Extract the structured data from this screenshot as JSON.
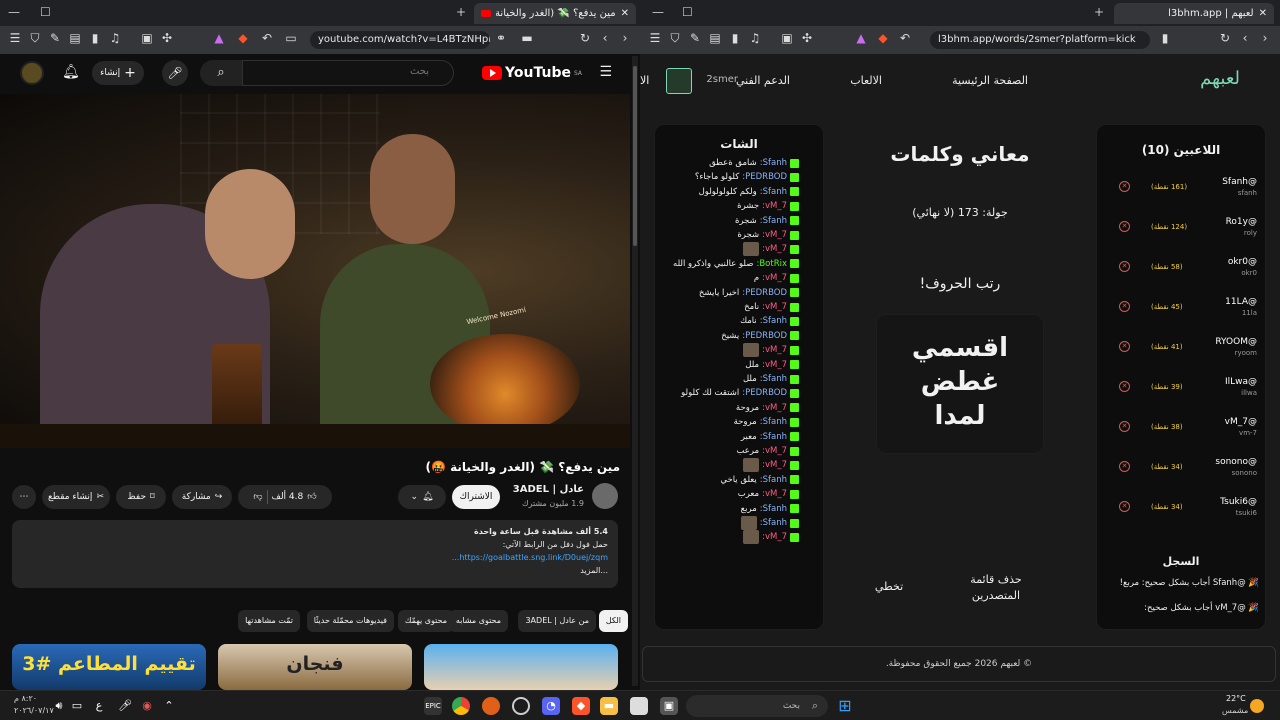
{
  "youtube_tab": {
    "title": "مين يدفع؟ 💸 (الغدر والخيانة🤬)",
    "url": "youtube.com/watch?v=L4BTzNHpHmc",
    "search_placeholder": "بحث",
    "create_label": "إنشاء",
    "logo": "YouTube",
    "country": "SA"
  },
  "video": {
    "title": "مين يدفع؟ 💸 (الغدر والخيانة 🤬)",
    "channel": "عادل | 3ADEL",
    "subscribers": "1.9 مليون مشترك",
    "subscribe_label": "الاشتراك",
    "likes": "4.8 ألف",
    "share_label": "مشاركة",
    "save_label": "حفظ",
    "clip_label": "إنشاء مقطع",
    "description": {
      "line1": "‎5.4 ألف مشاهدة قبل ساعة واحدة",
      "line2": "حمل فول دفل من الرابط الآتي:",
      "link": "https://goalbattle.sng.link/D0uej/zqm...",
      "more": "...المزيد"
    },
    "overlay_sign": "Welcome Nozomi"
  },
  "chips": [
    "الكل",
    "من عادل | 3ADEL",
    "محتوى مشابه",
    "محتوى يهمّك",
    "فيديوهات محمّلة حديثًا",
    "تمّت مشاهدتها"
  ],
  "thumbnails": [
    {
      "text": "تقييم المطاعم #3"
    },
    {
      "text": "فنجان"
    },
    {
      "text": ""
    }
  ],
  "l3bhm_tab": {
    "title": "لعبهم | l3bhm.app",
    "url": "l3bhm.app/words/2smer?platform=kick"
  },
  "nav": {
    "logo": "لعبهم",
    "home": "الصفحة الرئيسية",
    "games": "الالعاب",
    "support": "الدعم الفني",
    "user": "2smer",
    "extra": "الا"
  },
  "players": {
    "title": "اللاعبين (10)",
    "list": [
      {
        "name": "@Sfanh",
        "sub": "sfanh",
        "points": "(161 نقطة)"
      },
      {
        "name": "@Ro1y",
        "sub": "roly",
        "points": "(124 نقطة)"
      },
      {
        "name": "@okr0",
        "sub": "okr0",
        "points": "(58 نقطة)"
      },
      {
        "name": "@11LA",
        "sub": "11la",
        "points": "(45 نقطة)"
      },
      {
        "name": "@RYOOM",
        "sub": "ryoom",
        "points": "(41 نقطة)"
      },
      {
        "name": "@IlLwa",
        "sub": "illwa",
        "points": "(39 نقطة)"
      },
      {
        "name": "@vM_7",
        "sub": "vm-7",
        "points": "(38 نقطة)"
      },
      {
        "name": "@sonono",
        "sub": "sonono",
        "points": "(34 نقطة)"
      },
      {
        "name": "@Tsuki6",
        "sub": "tsuki6",
        "points": "(34 نقطة)"
      }
    ]
  },
  "log": {
    "title": "السجل",
    "entries": [
      "🎉 @Sfanh أجاب بشكل صحيح: مربع!",
      "🎉 @vM_7 أجاب بشكل صحيح:"
    ]
  },
  "game": {
    "title": "معاني وكلمات",
    "round": "جولة: 173 (لا نهائي)",
    "prompt": "رتب الحروف!",
    "scrambled": [
      "اقسمي",
      "غطض",
      "لمدا"
    ],
    "delete_leaderboard": "حذف قائمة المتصدرين",
    "skip": "تخطي"
  },
  "chat": {
    "title": "الشات",
    "messages": [
      {
        "user": "Sfanh:",
        "text": "شامق ةعطق",
        "c": ""
      },
      {
        "user": "PEDRBOD:",
        "text": "كلولو ماجاء؟",
        "c": ""
      },
      {
        "user": "Sfanh:",
        "text": "ولكم كلولولولول",
        "c": ""
      },
      {
        "user": "vM_7:",
        "text": "جشرة",
        "c": "red"
      },
      {
        "user": "Sfanh:",
        "text": "شجرة",
        "c": ""
      },
      {
        "user": "vM_7:",
        "text": "شجرة",
        "c": "red"
      },
      {
        "user": "vM_7:",
        "text": "",
        "c": "red",
        "avatar": true
      },
      {
        "user": "BotRix:",
        "text": "صلو عالنبي واذكرو الله",
        "c": "grn"
      },
      {
        "user": "vM_7:",
        "text": "م",
        "c": "red"
      },
      {
        "user": "PEDRBOD:",
        "text": "اخيرا يايشخ",
        "c": ""
      },
      {
        "user": "vM_7:",
        "text": "نامخ",
        "c": "red"
      },
      {
        "user": "Sfanh:",
        "text": "نامك",
        "c": ""
      },
      {
        "user": "PEDRBOD:",
        "text": "يشيخ",
        "c": ""
      },
      {
        "user": "vM_7:",
        "text": "",
        "c": "red",
        "avatar": true
      },
      {
        "user": "vM_7:",
        "text": "ملل",
        "c": "red"
      },
      {
        "user": "Sfanh:",
        "text": "ملل",
        "c": ""
      },
      {
        "user": "PEDRBOD:",
        "text": "اشتقت لك كلولو",
        "c": ""
      },
      {
        "user": "vM_7:",
        "text": "مروحة",
        "c": "red"
      },
      {
        "user": "Sfanh:",
        "text": "مروحة",
        "c": ""
      },
      {
        "user": "Sfanh:",
        "text": "معبر",
        "c": ""
      },
      {
        "user": "vM_7:",
        "text": "مرعب",
        "c": "red"
      },
      {
        "user": "vM_7:",
        "text": "",
        "c": "red",
        "avatar": true
      },
      {
        "user": "Sfanh:",
        "text": "يعلق ياخي",
        "c": ""
      },
      {
        "user": "vM_7:",
        "text": "معرب",
        "c": "red"
      },
      {
        "user": "Sfanh:",
        "text": "مربع",
        "c": ""
      },
      {
        "user": "Sfanh:",
        "text": "",
        "c": "",
        "avatar": true
      },
      {
        "user": "vM_7:",
        "text": "",
        "c": "red",
        "avatar": true
      }
    ]
  },
  "footer": "© لعبهم 2026 جميع الحقوق محفوظة.",
  "taskbar": {
    "search": "بحث",
    "weather_temp": "22°C",
    "weather_desc": "مشمس",
    "time": "٨:٢٠ م",
    "date": "٢٠٢٦/٠٧/١٧",
    "lang": "ع"
  }
}
